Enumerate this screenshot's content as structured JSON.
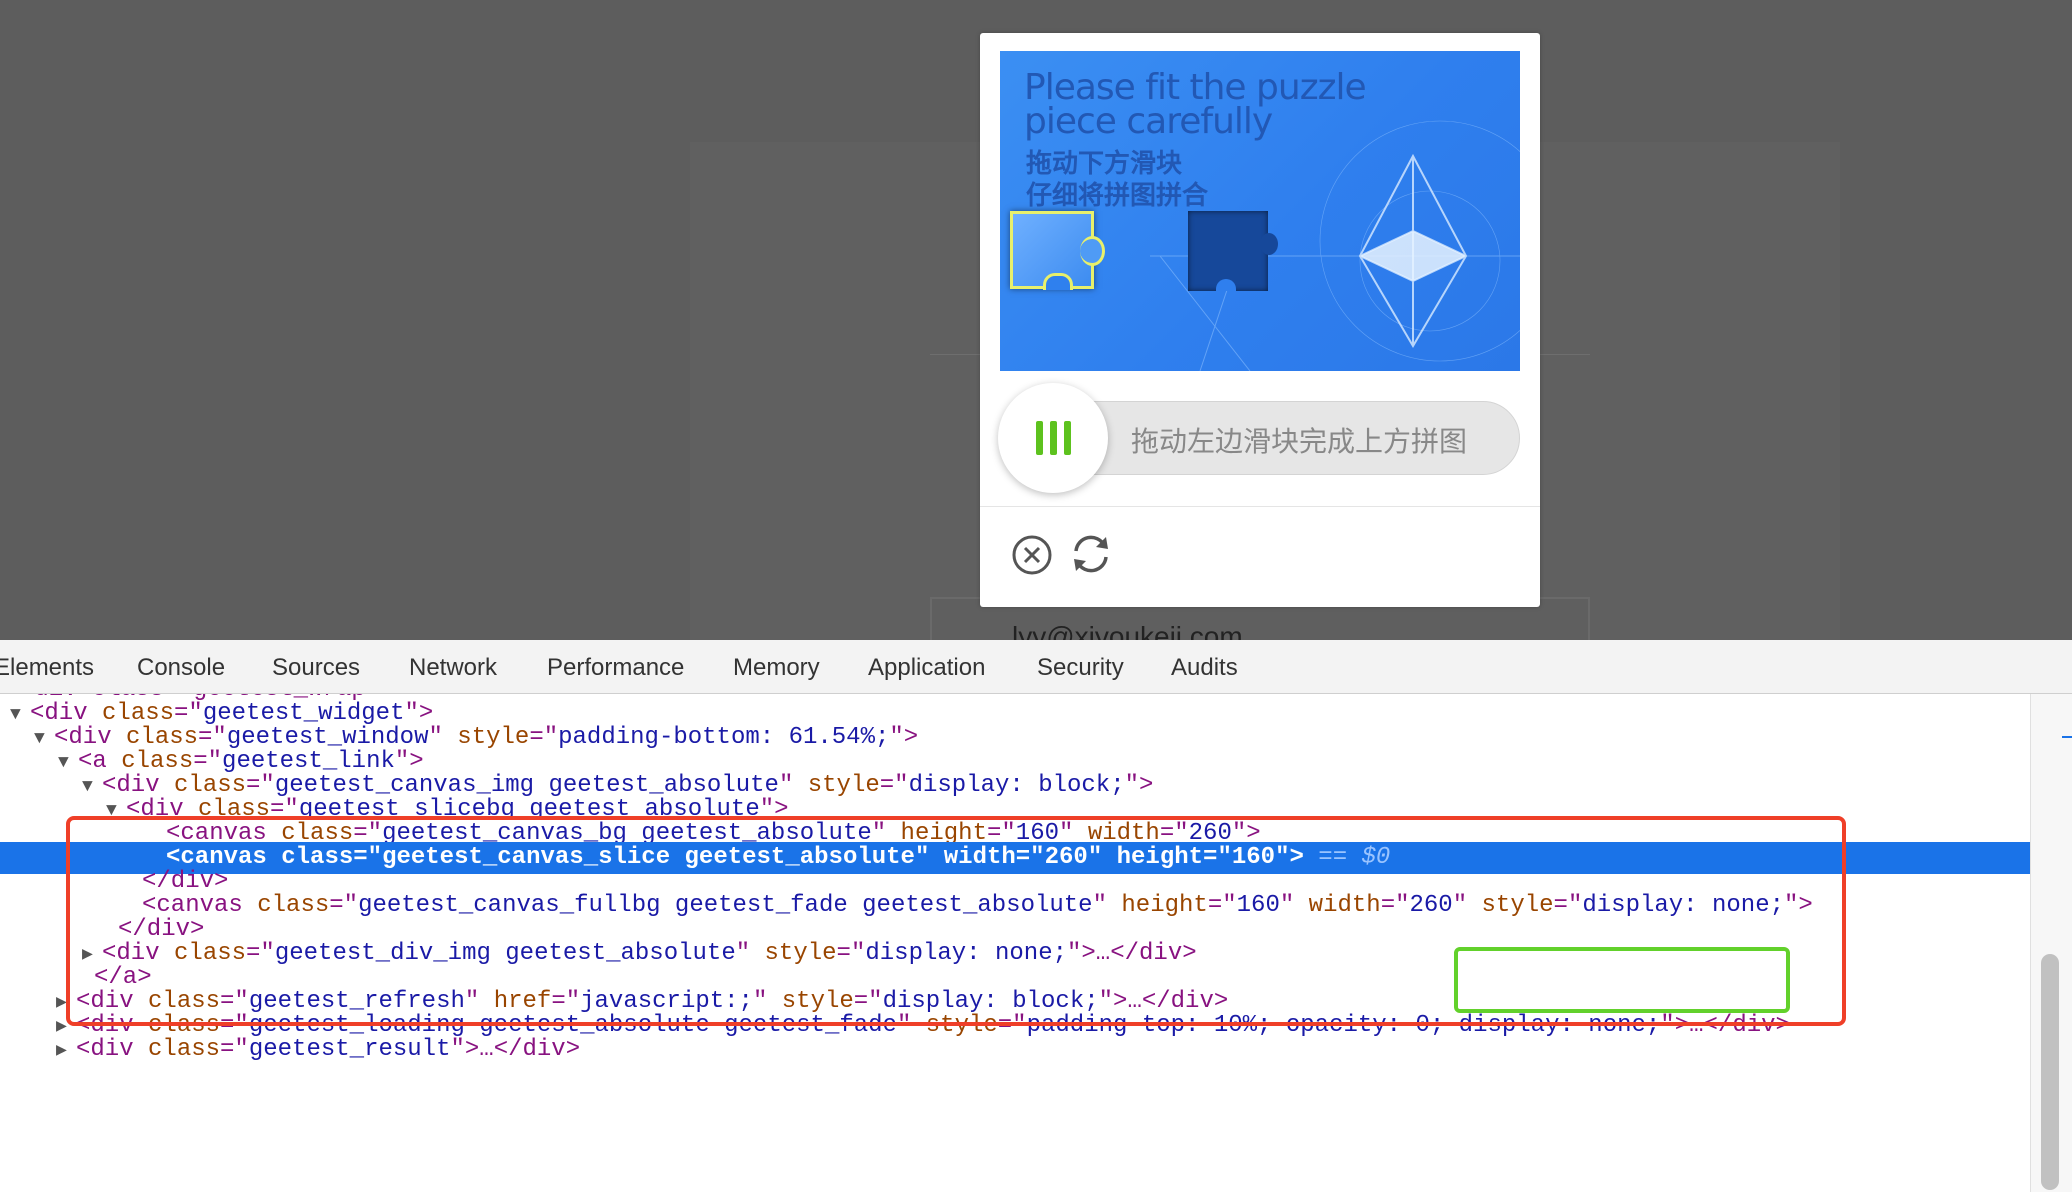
{
  "page": {
    "email_partial": "lyy@xiyoukeji.com"
  },
  "captcha": {
    "hint_en": "Please fit the puzzle piece carefully",
    "hint_cn_line1": "拖动下方滑块",
    "hint_cn_line2": "仔细将拼图拼合",
    "slider_text": "拖动左边滑块完成上方拼图",
    "close_icon": "close-circle-icon",
    "refresh_icon": "refresh-icon",
    "slider_icon": "drag-handle-icon",
    "accent": "#5dc21e"
  },
  "devtools": {
    "tabs": [
      "Elements",
      "Console",
      "Sources",
      "Network",
      "Performance",
      "Memory",
      "Application",
      "Security",
      "Audits"
    ],
    "active_tab": "Elements",
    "lines": [
      {
        "tri": "",
        "text": "<div class=\"geetest_wrap\">"
      },
      {
        "tri": "▼",
        "tag": "div",
        "attrs": [
          [
            "class",
            "geetest_widget"
          ]
        ],
        "close": ">"
      },
      {
        "tri": "▼",
        "tag": "div",
        "attrs": [
          [
            "class",
            "geetest_window"
          ],
          [
            "style",
            "padding-bottom: 61.54%;"
          ]
        ],
        "close": ">"
      },
      {
        "tri": "▼",
        "tag": "a",
        "attrs": [
          [
            "class",
            "geetest_link"
          ]
        ],
        "close": ">"
      },
      {
        "tri": "▼",
        "tag": "div",
        "attrs": [
          [
            "class",
            "geetest_canvas_img geetest_absolute"
          ],
          [
            "style",
            "display: block;"
          ]
        ],
        "close": ">"
      },
      {
        "tri": "▼",
        "tag": "div",
        "attrs": [
          [
            "class",
            "geetest_slicebg geetest_absolute"
          ]
        ],
        "close": ">"
      },
      {
        "tri": "",
        "tag": "canvas",
        "attrs": [
          [
            "class",
            "geetest_canvas_bg geetest_absolute"
          ],
          [
            "height",
            "160"
          ],
          [
            "width",
            "260"
          ]
        ],
        "close": ">"
      },
      {
        "tri": "",
        "tag": "canvas",
        "attrs": [
          [
            "class",
            "geetest_canvas_slice geetest_absolute"
          ],
          [
            "width",
            "260"
          ],
          [
            "height",
            "160"
          ]
        ],
        "close": ">",
        "suffix": " == $0"
      },
      {
        "tri": "",
        "text": "</div>"
      },
      {
        "tri": "",
        "tag": "canvas",
        "attrs": [
          [
            "class",
            "geetest_canvas_fullbg geetest_fade geetest_absolute"
          ],
          [
            "height",
            "160"
          ],
          [
            "width",
            "260"
          ],
          [
            "style",
            "display: none;"
          ]
        ],
        "close": ">"
      },
      {
        "tri": "",
        "text": "</div>"
      },
      {
        "tri": "▶",
        "tag": "div",
        "attrs": [
          [
            "class",
            "geetest_div_img geetest_absolute"
          ],
          [
            "style",
            "display: none;"
          ]
        ],
        "close": ">…</div>"
      },
      {
        "tri": "",
        "text": "</a>"
      },
      {
        "tri": "▶",
        "tag": "div",
        "attrs": [
          [
            "class",
            "geetest_refresh"
          ],
          [
            "href",
            "javascript:;"
          ],
          [
            "style",
            "display: block;"
          ]
        ],
        "close": ">…</div>"
      },
      {
        "tri": "▶",
        "tag": "div",
        "attrs": [
          [
            "class",
            "geetest_loading geetest_absolute geetest_fade"
          ],
          [
            "style",
            "padding-top: 10%; opacity: 0; display: none;"
          ]
        ],
        "close": ">…</div>"
      },
      {
        "tri": "▶",
        "tag": "div",
        "attrs": [
          [
            "class",
            "geetest_result"
          ]
        ],
        "close": ">…</div>"
      }
    ],
    "selected_line": 7
  }
}
